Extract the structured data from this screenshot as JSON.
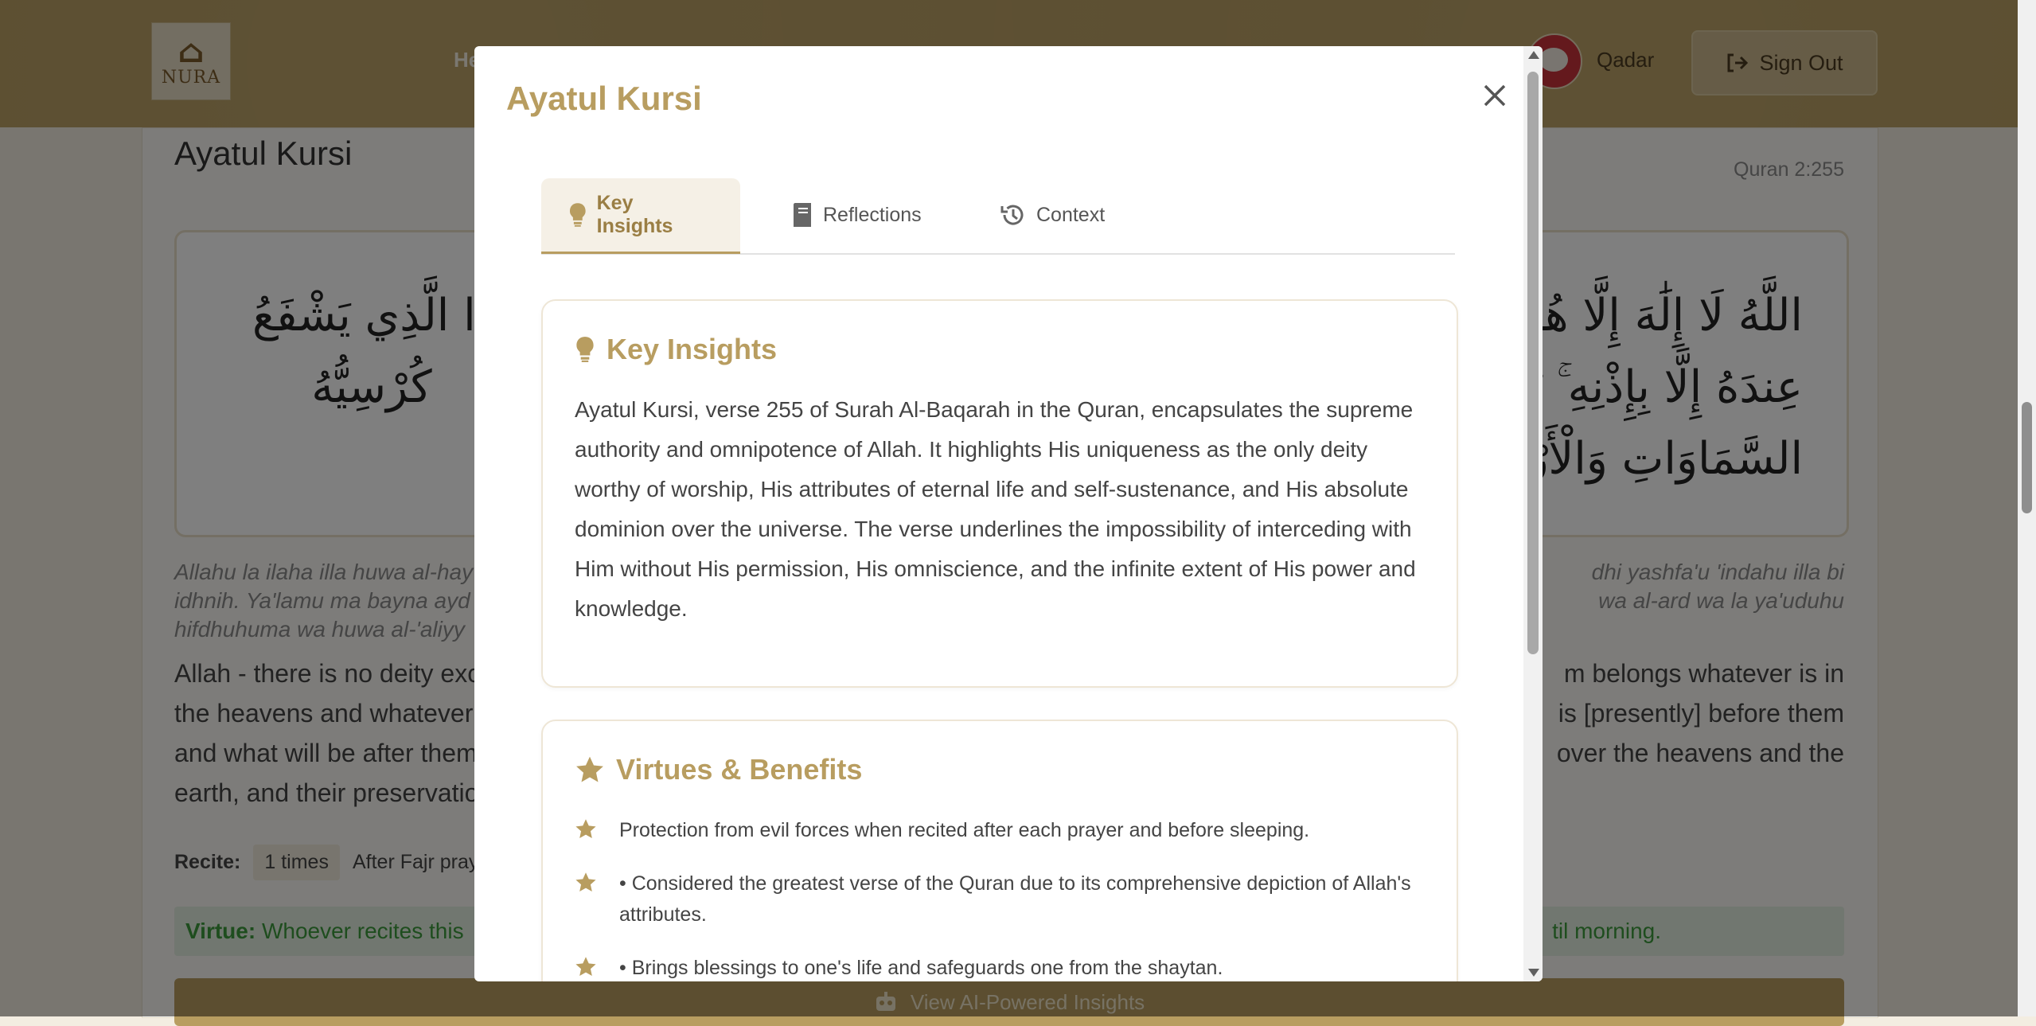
{
  "header": {
    "logo_text": "NURA",
    "nav_home": "He",
    "username": "Qadar",
    "signout_label": "Sign Out"
  },
  "card": {
    "title": "Ayatul Kursi",
    "reference": "Quran 2:255",
    "arabic_left_1": "ذَا الَّذِي يَشْفَعُ",
    "arabic_left_2": "كُرْسِيُّهُ",
    "arabic_right_1": "اللَّهُ لَا إِلَٰهَ إِلَّا هُوَ الْ",
    "arabic_right_2": "عِندَهُ إِلَّا بِإِذْنِهِ ۚ يَعْلَ",
    "arabic_right_3": "السَّمَاوَاتِ وَالْأَرْضَ",
    "translit_left_1": "Allahu la ilaha illa huwa al-hay",
    "translit_left_2": "idhnih. Ya'lamu ma bayna ayd",
    "translit_left_3": "hifdhuhuma wa huwa al-'aliyy",
    "translit_right_1": "dhi yashfa'u 'indahu illa bi",
    "translit_right_2": "wa al-ard wa la ya'uduhu",
    "translation_left_1": "Allah - there is no deity exc",
    "translation_left_2": "the heavens and whatever i",
    "translation_left_3": "and what will be after them",
    "translation_left_4": "earth, and their preservatio",
    "translation_right_1": "m belongs whatever is in",
    "translation_right_2": "is [presently] before them",
    "translation_right_3": "over the heavens and the",
    "recite_label": "Recite:",
    "recite_count": "1 times",
    "recite_when": "After Fajr pray",
    "virtue_label": "Virtue:",
    "virtue_text_left": "Whoever recites this",
    "virtue_text_right": "til morning.",
    "ai_button_label": "View AI-Powered Insights"
  },
  "modal": {
    "title": "Ayatul Kursi",
    "tabs": [
      {
        "label": "Key Insights",
        "icon": "lightbulb-icon",
        "active": true
      },
      {
        "label": "Reflections",
        "icon": "book-icon",
        "active": false
      },
      {
        "label": "Context",
        "icon": "history-icon",
        "active": false
      }
    ],
    "key_insights": {
      "title": "Key Insights",
      "text": "Ayatul Kursi, verse 255 of Surah Al-Baqarah in the Quran, encapsulates the supreme authority and omnipotence of Allah. It highlights His uniqueness as the only deity worthy of worship, His attributes of eternal life and self-sustenance, and His absolute dominion over the universe. The verse underlines the impossibility of interceding with Him without His permission, His omniscience, and the infinite extent of His power and knowledge."
    },
    "virtues": {
      "title": "Virtues & Benefits",
      "items": [
        "Protection from evil forces when recited after each prayer and before sleeping.",
        "• Considered the greatest verse of the Quran due to its comprehensive depiction of Allah's attributes.",
        "• Brings blessings to one's life and safeguards one from the shaytan."
      ]
    }
  },
  "colors": {
    "accent": "#b89d60",
    "virtue_green": "#3c9a3c"
  }
}
